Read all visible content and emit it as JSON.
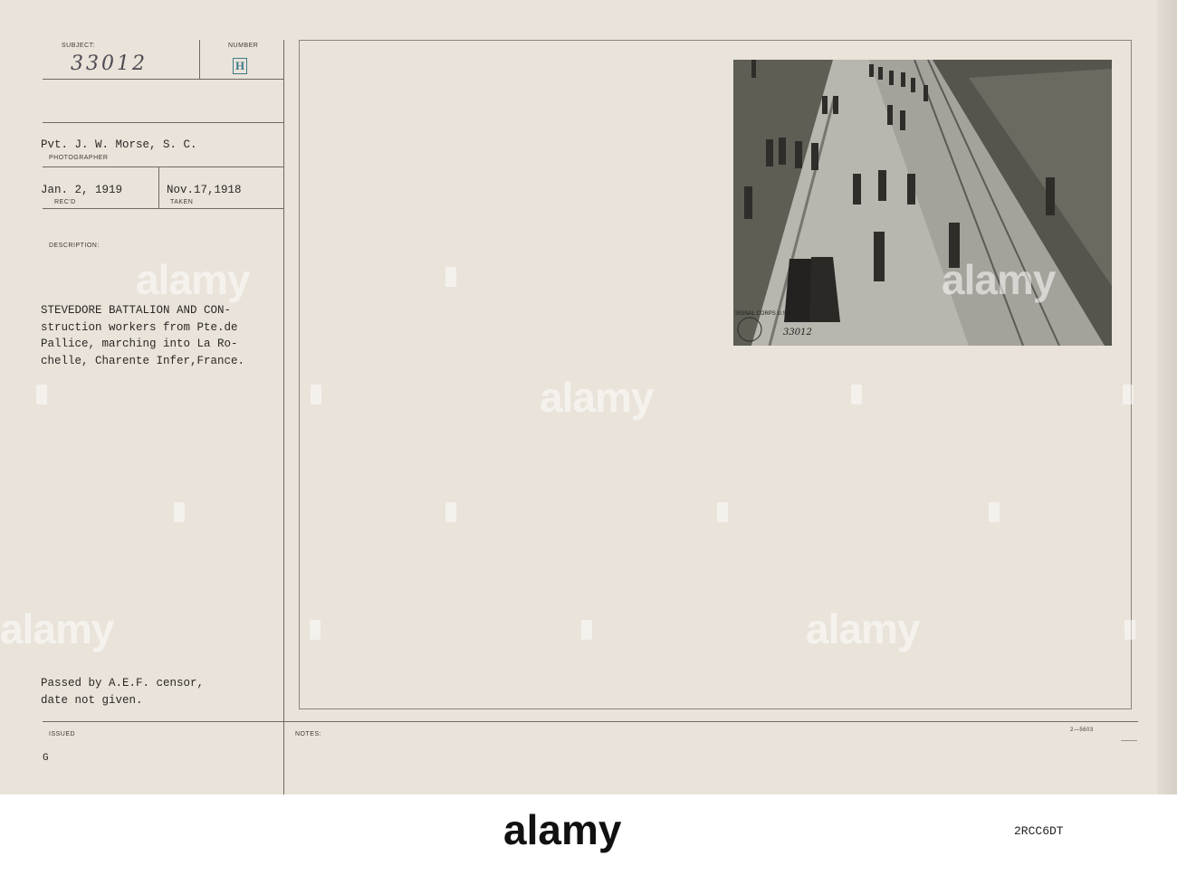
{
  "form": {
    "subject_label": "SUBJECT:",
    "subject_value": "33012",
    "number_label": "NUMBER",
    "number_stamp": "H",
    "photographer": "Pvt. J. W. Morse, S. C.",
    "photographer_label": "PHOTOGRAPHER",
    "received": "Jan. 2, 1919",
    "received_label": "REC'D",
    "taken": "Nov.17,1918",
    "taken_label": "TAKEN",
    "description_label": "DESCRIPTION:",
    "description_lines": [
      "STEVEDORE BATTALION AND CON-",
      "struction workers from Pte.de",
      "Pallice, marching into La Ro-",
      "chelle, Charente Infer,France."
    ],
    "censor_lines": [
      "Passed by A.E.F. censor,",
      "date not given."
    ],
    "issued_label": "ISSUED",
    "issued_value": "G",
    "notes_label": "NOTES:",
    "form_code": "2—5603"
  },
  "photo": {
    "signal_corps_mark": "SIGNAL CORPS U.S.A.",
    "negative_number": "33012"
  },
  "watermark": {
    "text": "alamy",
    "footer_logo": "alamy",
    "stock_code": "2RCC6DT"
  }
}
